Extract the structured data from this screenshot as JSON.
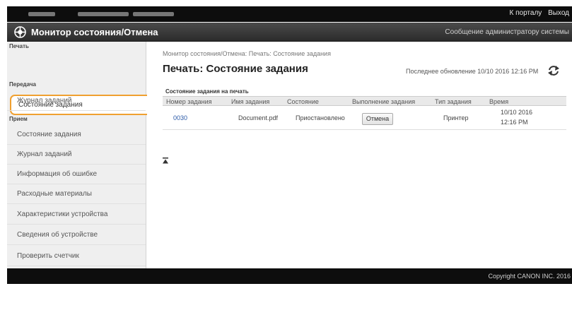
{
  "topbar": {
    "links": {
      "portal": "К порталу",
      "logout": "Выход"
    },
    "colors": {
      "background": "#0d0d0d"
    }
  },
  "header": {
    "title": "Монитор состояния/Отмена",
    "admin_message": "Сообщение администратору системы",
    "logo_icon": "canon-monitor-logo-icon"
  },
  "sidebar": {
    "sections": [
      {
        "label": "Печать"
      },
      {
        "label": "Передача"
      },
      {
        "label": "Прием"
      }
    ],
    "items": [
      {
        "label": "Состояние задания"
      },
      {
        "label": "Журнал заданий"
      },
      {
        "label": "Состояние задания"
      },
      {
        "label": "Журнал заданий"
      },
      {
        "label": "Информация об ошибке"
      },
      {
        "label": "Расходные материалы"
      },
      {
        "label": "Характеристики устройства"
      },
      {
        "label": "Сведения об устройстве"
      },
      {
        "label": "Проверить счетчик"
      }
    ],
    "selected_index": 0,
    "highlight_color": "#f0a030"
  },
  "main": {
    "breadcrumb": "Монитор состояния/Отмена: Печать: Состояние задания",
    "page_title": "Печать: Состояние задания",
    "last_update": "Последнее обновление 10/10 2016 12:16 PM",
    "refresh_icon": "refresh-icon",
    "panel_title": "Состояние задания на печать",
    "columns": [
      "Номер задания",
      "Имя задания",
      "Состояние",
      "Выполнение задания",
      "Тип задания",
      "Время"
    ],
    "rows": [
      {
        "job_number": "0030",
        "job_name": "Document.pdf",
        "status": "Приостановлено",
        "action": "Отмена",
        "job_type": "Принтер",
        "time_line1": "10/10 2016",
        "time_line2": "12:16 PM"
      }
    ],
    "page_top_icon": "page-top-arrow-icon"
  },
  "footer": {
    "copyright": "Copyright CANON INC. 2016"
  }
}
